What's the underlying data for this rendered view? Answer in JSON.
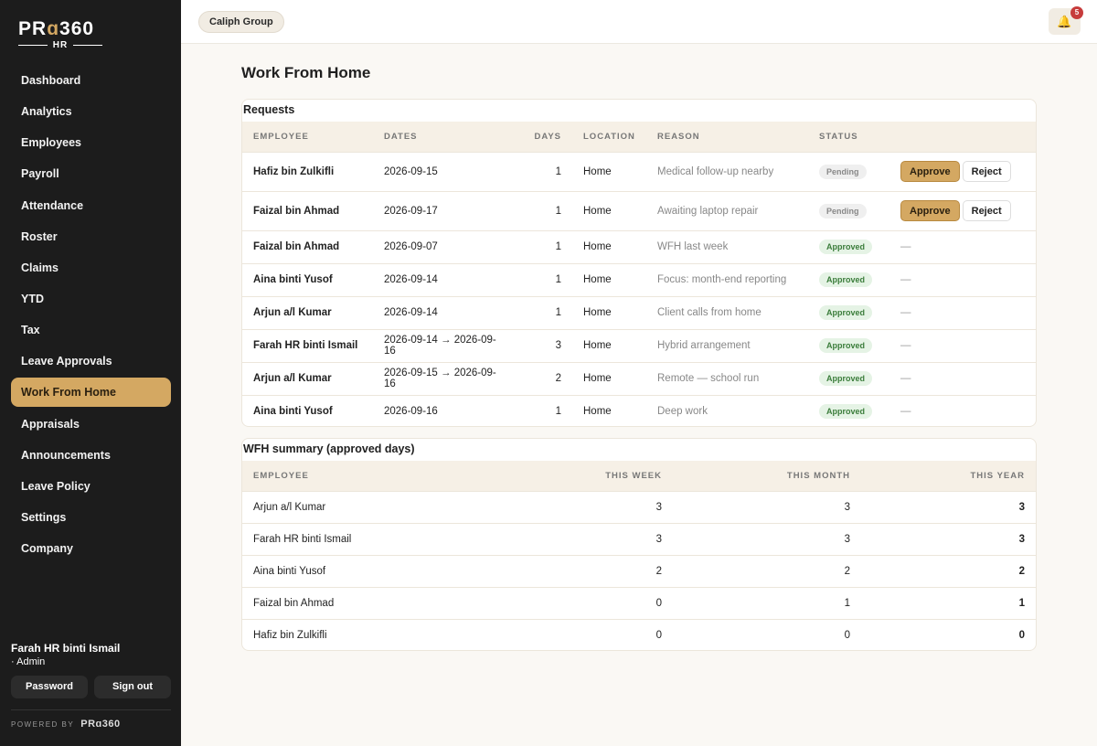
{
  "brand": {
    "logo_main_a": "PR",
    "logo_main_b": "ɑ",
    "logo_main_c": "360",
    "logo_sub": "HR",
    "powered_label": "POWERED BY",
    "powered_logo": "PRɑ360"
  },
  "sidebar": {
    "items": [
      {
        "label": "Dashboard"
      },
      {
        "label": "Analytics"
      },
      {
        "label": "Employees"
      },
      {
        "label": "Payroll"
      },
      {
        "label": "Attendance"
      },
      {
        "label": "Roster"
      },
      {
        "label": "Claims"
      },
      {
        "label": "YTD"
      },
      {
        "label": "Tax"
      },
      {
        "label": "Leave Approvals"
      },
      {
        "label": "Work From Home",
        "active": true
      },
      {
        "label": "Appraisals"
      },
      {
        "label": "Announcements"
      },
      {
        "label": "Leave Policy"
      },
      {
        "label": "Settings"
      },
      {
        "label": "Company"
      }
    ],
    "user": {
      "name": "Farah HR binti Ismail",
      "role": "· Admin"
    },
    "password_label": "Password",
    "signout_label": "Sign out"
  },
  "topbar": {
    "org": "Caliph Group",
    "bell_icon": "bell-icon",
    "notif_count": "5"
  },
  "page": {
    "title": "Work From Home"
  },
  "requests": {
    "title": "Requests",
    "columns": [
      "EMPLOYEE",
      "DATES",
      "DAYS",
      "LOCATION",
      "REASON",
      "STATUS"
    ],
    "rows": [
      {
        "employee": "Hafiz bin Zulkifli",
        "dates": "2026-09-15",
        "days": "1",
        "location": "Home",
        "reason": "Medical follow-up nearby",
        "status": "Pending",
        "approve": "Approve",
        "reject": "Reject"
      },
      {
        "employee": "Faizal bin Ahmad",
        "dates": "2026-09-17",
        "days": "1",
        "location": "Home",
        "reason": "Awaiting laptop repair",
        "status": "Pending",
        "approve": "Approve",
        "reject": "Reject"
      },
      {
        "employee": "Faizal bin Ahmad",
        "dates": "2026-09-07",
        "days": "1",
        "location": "Home",
        "reason": "WFH last week",
        "status": "Approved",
        "action": "—"
      },
      {
        "employee": "Aina binti Yusof",
        "dates": "2026-09-14",
        "days": "1",
        "location": "Home",
        "reason": "Focus: month-end reporting",
        "status": "Approved",
        "action": "—"
      },
      {
        "employee": "Arjun a/l Kumar",
        "dates": "2026-09-14",
        "days": "1",
        "location": "Home",
        "reason": "Client calls from home",
        "status": "Approved",
        "action": "—"
      },
      {
        "employee": "Farah HR binti Ismail",
        "dates": "2026-09-14 → 2026-09-16",
        "days": "3",
        "location": "Home",
        "reason": "Hybrid arrangement",
        "status": "Approved",
        "action": "—"
      },
      {
        "employee": "Arjun a/l Kumar",
        "dates": "2026-09-15 → 2026-09-16",
        "days": "2",
        "location": "Home",
        "reason": "Remote — school run",
        "status": "Approved",
        "action": "—"
      },
      {
        "employee": "Aina binti Yusof",
        "dates": "2026-09-16",
        "days": "1",
        "location": "Home",
        "reason": "Deep work",
        "status": "Approved",
        "action": "—"
      }
    ]
  },
  "summary": {
    "title": "WFH summary (approved days)",
    "columns": [
      "EMPLOYEE",
      "THIS WEEK",
      "THIS MONTH",
      "THIS YEAR"
    ],
    "rows": [
      {
        "employee": "Arjun a/l Kumar",
        "week": "3",
        "month": "3",
        "year": "3"
      },
      {
        "employee": "Farah HR binti Ismail",
        "week": "3",
        "month": "3",
        "year": "3"
      },
      {
        "employee": "Aina binti Yusof",
        "week": "2",
        "month": "2",
        "year": "2"
      },
      {
        "employee": "Faizal bin Ahmad",
        "week": "0",
        "month": "1",
        "year": "1"
      },
      {
        "employee": "Hafiz bin Zulkifli",
        "week": "0",
        "month": "0",
        "year": "0"
      }
    ]
  }
}
